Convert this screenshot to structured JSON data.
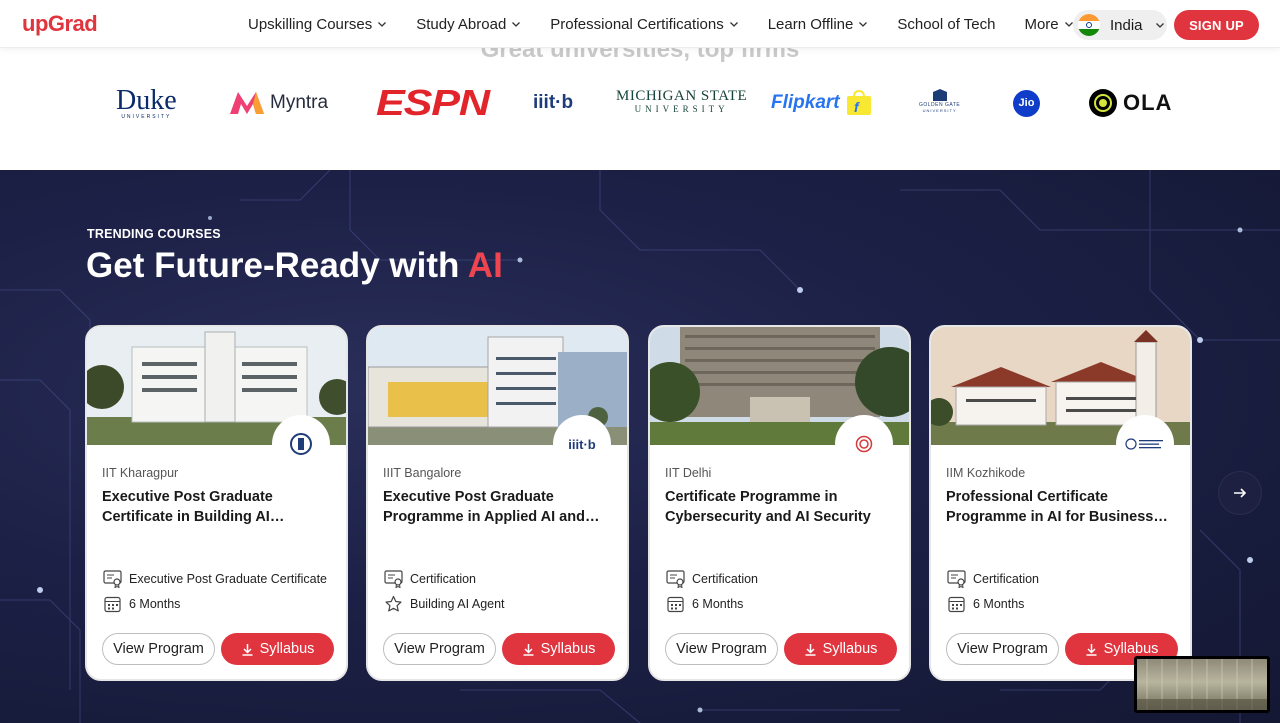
{
  "brand": {
    "logo_text": "upGrad",
    "accent": "#e0353f"
  },
  "nav": {
    "items": [
      {
        "label": "Upskilling Courses",
        "dropdown": true
      },
      {
        "label": "Study Abroad",
        "dropdown": true
      },
      {
        "label": "Professional Certifications",
        "dropdown": true
      },
      {
        "label": "Learn Offline",
        "dropdown": true
      },
      {
        "label": "School of Tech",
        "dropdown": false
      },
      {
        "label": "More",
        "dropdown": true
      }
    ],
    "country": "India",
    "signup": "SIGN UP"
  },
  "partners": {
    "heading": "Great universities, top firms",
    "logos": [
      {
        "name": "duke-logo",
        "text": "Duke",
        "sub": "UNIVERSITY"
      },
      {
        "name": "myntra-logo",
        "text": "Myntra"
      },
      {
        "name": "espn-logo",
        "text": "ESPN"
      },
      {
        "name": "iiitb-logo",
        "text": "iiit·b"
      },
      {
        "name": "michigan-state-logo",
        "text": "MICHIGAN STATE",
        "sub": "UNIVERSITY"
      },
      {
        "name": "flipkart-logo",
        "text": "Flipkart"
      },
      {
        "name": "golden-gate-logo",
        "text": "GOLDEN GATE",
        "sub": "UNIVERSITY"
      },
      {
        "name": "jio-logo",
        "text": "Jio"
      },
      {
        "name": "ola-logo",
        "text": "OLA"
      }
    ]
  },
  "trending": {
    "eyebrow": "TRENDING COURSES",
    "headline": "Get Future-Ready with ",
    "headline_accent": "AI",
    "cards": [
      {
        "institute": "IIT Kharagpur",
        "title": "Executive Post Graduate Certificate in Building AI Products…",
        "meta1": "Executive Post Graduate Certificate",
        "meta2": "6 Months",
        "meta2_icon": "calendar-icon",
        "view": "View Program",
        "syllabus": "Syllabus"
      },
      {
        "institute": "IIIT Bangalore",
        "title": "Executive Post Graduate Programme in Applied AI and…",
        "meta1": "Certification",
        "meta2": "Building AI Agent",
        "meta2_icon": "star-icon",
        "view": "View Program",
        "syllabus": "Syllabus"
      },
      {
        "institute": "IIT Delhi",
        "title": "Certificate Programme in Cybersecurity and AI Security",
        "meta1": "Certification",
        "meta2": "6 Months",
        "meta2_icon": "calendar-icon",
        "view": "View Program",
        "syllabus": "Syllabus"
      },
      {
        "institute": "IIM Kozhikode",
        "title": "Professional Certificate Programme in AI for Business Professionals",
        "meta1": "Certification",
        "meta2": "6 Months",
        "meta2_icon": "calendar-icon",
        "view": "View Program",
        "syllabus": "Syllabus"
      }
    ]
  }
}
